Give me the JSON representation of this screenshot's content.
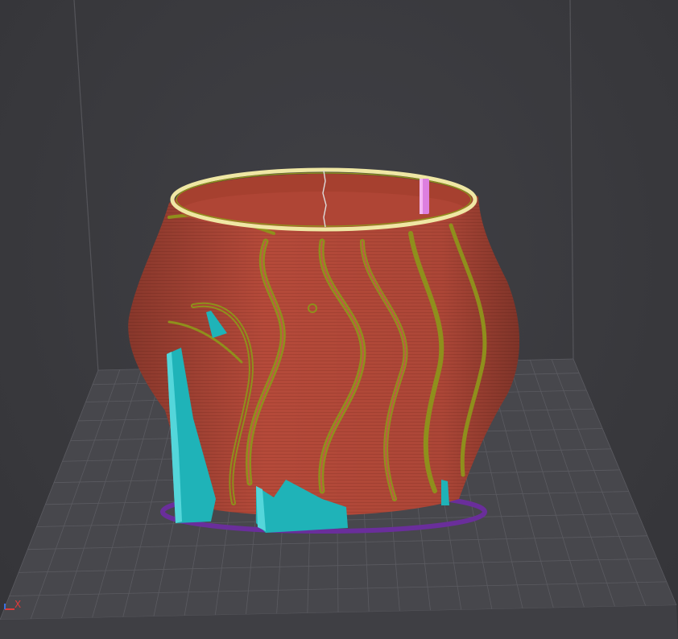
{
  "viewport": {
    "axis_x_label": "X"
  },
  "colors": {
    "background": "#3b3b3f",
    "build_plate": "#47474c",
    "grid_line": "#5b5b61",
    "outer_wall": "#b54a3a",
    "inner_wall": "#8f8f1c",
    "top_rim": "#efe7a4",
    "support": "#1fb3b8",
    "skirt_brim": "#6a2e9b",
    "travel_marker": "#dd7fe0",
    "axis_x": "#e03a3a",
    "axis_y": "#32b84a",
    "axis_z": "#3a6fe0"
  }
}
